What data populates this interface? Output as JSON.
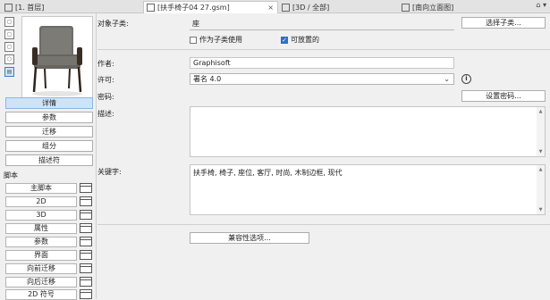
{
  "tabs": [
    {
      "label": "[1. 首层]",
      "icon": "floor-plan-icon"
    },
    {
      "label": "[扶手椅子04 27.gsm]",
      "icon": "gdl-object-icon",
      "close": "×"
    },
    {
      "label": "[3D / 全部]",
      "icon": "3d-view-icon"
    },
    {
      "label": "[南向立面图]",
      "icon": "elevation-icon"
    }
  ],
  "tab_menu": "⌂ ▾",
  "sidebar": {
    "icons": [
      "◻",
      "◻",
      "◻",
      "⬡",
      "▤"
    ],
    "nav": [
      "详情",
      "参数",
      "迁移",
      "组分",
      "描述符"
    ],
    "scripts_title": "脚本",
    "scripts": [
      "主脚本",
      "2D",
      "3D",
      "属性",
      "参数",
      "界面",
      "向前迁移",
      "向后迁移",
      "2D 符号"
    ]
  },
  "details": {
    "subtype_label": "对象子类:",
    "subtype_value": "座",
    "select_subtype_button": "选择子类...",
    "placeable_as_library": "作为子类使用",
    "placeable": "可放置的",
    "author_label": "作者:",
    "author_value": "Graphisoft",
    "license_label": "许可:",
    "license_value": "署名 4.0",
    "password_label": "密码:",
    "set_password_button": "设置密码...",
    "description_label": "描述:",
    "description_value": "",
    "keywords_label": "关键字:",
    "keywords_value": "扶手椅, 椅子, 座位, 客厅, 时尚, 木制边框, 现代",
    "compat_button": "兼容性选项..."
  },
  "colors": {
    "accent": "#2f6fc4",
    "selected_bg": "#cfe3f7"
  }
}
